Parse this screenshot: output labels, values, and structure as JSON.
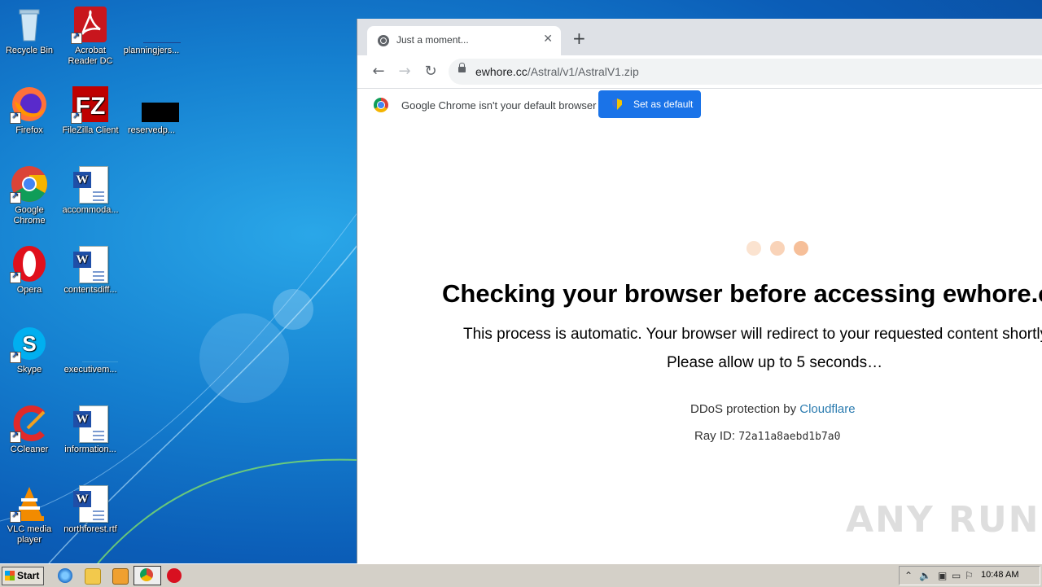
{
  "desktop": {
    "icons": [
      {
        "label": "Recycle Bin"
      },
      {
        "label": "Acrobat Reader DC"
      },
      {
        "label": "planningjers..."
      },
      {
        "label": "Firefox"
      },
      {
        "label": "FileZilla Client"
      },
      {
        "label": "reservedp..."
      },
      {
        "label": "Google Chrome"
      },
      {
        "label": "accommoda..."
      },
      {
        "label": "Opera"
      },
      {
        "label": "contentsdiff..."
      },
      {
        "label": "Skype"
      },
      {
        "label": "executivem..."
      },
      {
        "label": "CCleaner"
      },
      {
        "label": "information..."
      },
      {
        "label": "VLC media player"
      },
      {
        "label": "northforest.rtf"
      }
    ]
  },
  "browser": {
    "tab_title": "Just a moment...",
    "tab_close": "✕",
    "new_tab": "+",
    "url_host": "ewhore.cc",
    "url_path": "/Astral/v1/AstralV1.zip",
    "infobar_text": "Google Chrome isn't your default browser",
    "set_default_label": "Set as default"
  },
  "page": {
    "heading": "Checking your browser before accessing ewhore.cc.",
    "line1": "This process is automatic. Your browser will redirect to your requested content shortly.",
    "line2": "Please allow up to 5 seconds…",
    "ddos_prefix": "DDoS protection by ",
    "ddos_link": "Cloudflare",
    "ray_prefix": "Ray ID: ",
    "ray_id": "72a11a8aebd1b7a0",
    "dot_colors": [
      "#fbe3d0",
      "#f9d3b8",
      "#f6bf99"
    ],
    "watermark": "ANY RUN"
  },
  "taskbar": {
    "start_label": "Start",
    "clock": "10:48 AM"
  }
}
